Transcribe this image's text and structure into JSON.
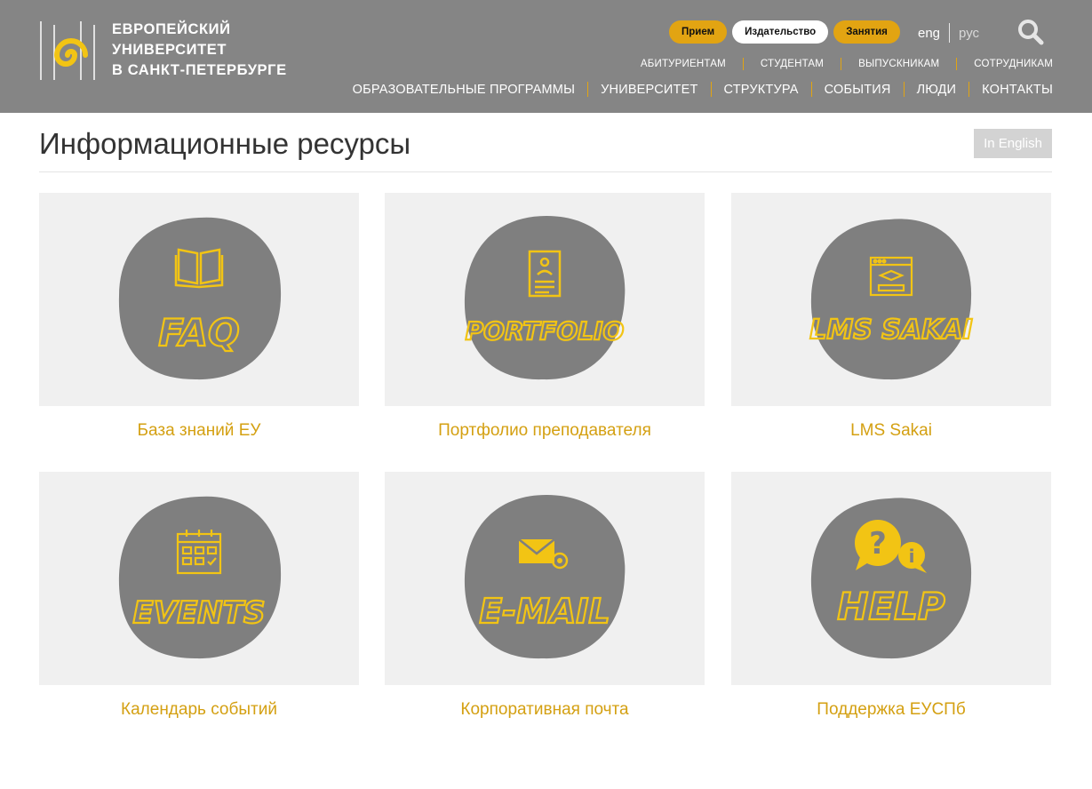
{
  "header": {
    "logo_lines": [
      "ЕВРОПЕЙСКИЙ",
      "УНИВЕРСИТЕТ",
      "В САНКТ-ПЕТЕРБУРГЕ"
    ],
    "pills": [
      {
        "label": "Прием",
        "style": "yellow"
      },
      {
        "label": "Издательство",
        "style": "white"
      },
      {
        "label": "Занятия",
        "style": "yellow"
      }
    ],
    "lang_active": "eng",
    "lang_inactive": "рус",
    "search_icon": "search-icon",
    "subnav": [
      "АБИТУРИЕНТАМ",
      "СТУДЕНТАМ",
      "ВЫПУСКНИКАМ",
      "СОТРУДНИКАМ"
    ],
    "mainnav": [
      "ОБРАЗОВАТЕЛЬНЫЕ ПРОГРАММЫ",
      "УНИВЕРСИТЕТ",
      "СТРУКТУРА",
      "СОБЫТИЯ",
      "ЛЮДИ",
      "КОНТАКТЫ"
    ]
  },
  "page": {
    "title": "Информационные ресурсы",
    "english_button": "In English"
  },
  "cards": [
    {
      "label": "База знаний ЕУ",
      "image_text": "FAQ",
      "icon": "book-icon"
    },
    {
      "label": "Портфолио преподавателя",
      "image_text": "PORTFOLIO",
      "icon": "profile-document-icon"
    },
    {
      "label": "LMS Sakai",
      "image_text": "LMS SAKAI",
      "icon": "browser-graduation-icon"
    },
    {
      "label": "Календарь событий",
      "image_text": "EVENTS",
      "icon": "calendar-icon"
    },
    {
      "label": "Корпоративная почта",
      "image_text": "E-MAIL",
      "icon": "envelope-at-icon"
    },
    {
      "label": "Поддержка ЕУСПб",
      "image_text": "HELP",
      "icon": "question-info-bubbles-icon"
    }
  ],
  "colors": {
    "header_bg": "#858585",
    "accent": "#e2a412",
    "icon_yellow": "#f2c414",
    "blob": "#7f7f7f",
    "card_bg": "#f0f0f0",
    "label": "#d4a012"
  }
}
